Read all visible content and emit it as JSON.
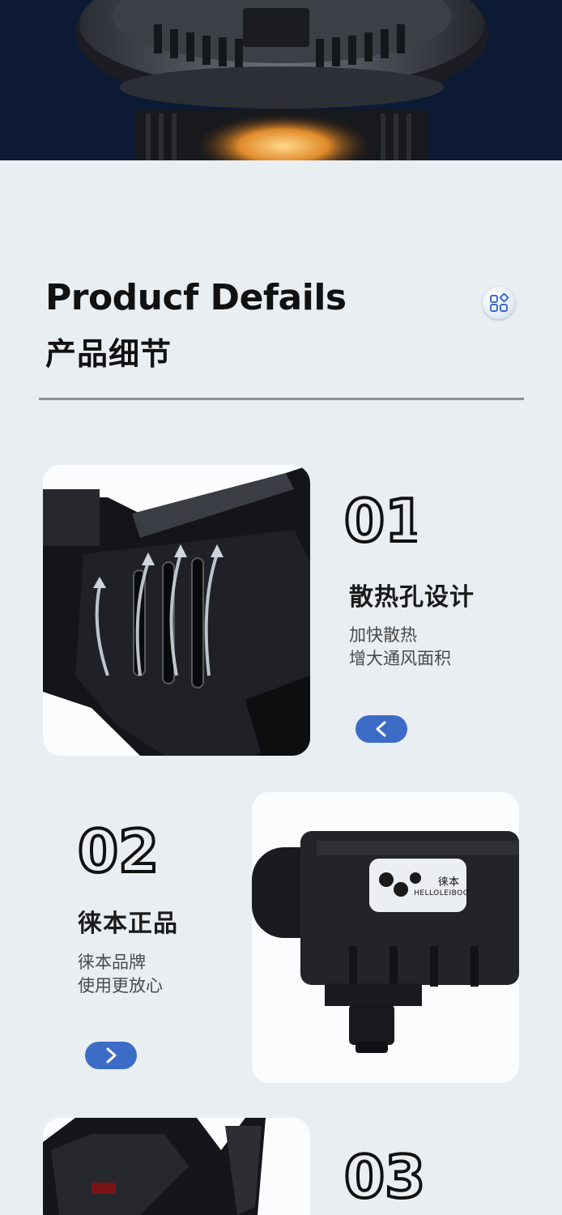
{
  "header": {
    "title_en": "Producf Defails",
    "title_cn": "产品细节"
  },
  "menu_button": {
    "icon": "grid-icon"
  },
  "features": [
    {
      "number": "01",
      "title": "散热孔设计",
      "desc_line1": "加快散热",
      "desc_line2": "增大通风面积",
      "nav_icon": "chevron-left-icon"
    },
    {
      "number": "02",
      "title": "徕本正品",
      "desc_line1": "徕本品牌",
      "desc_line2": "使用更放心",
      "nav_icon": "chevron-right-icon",
      "product_label": {
        "brand_cn": "徕本",
        "brand_en": "HELLOLEIBOO"
      }
    },
    {
      "number": "03"
    }
  ],
  "colors": {
    "accent": "#3d6cc7",
    "background": "#e9eef2",
    "hero": "#0c1a33"
  }
}
